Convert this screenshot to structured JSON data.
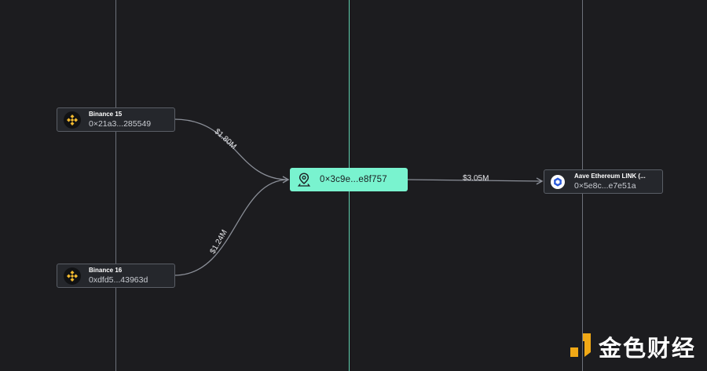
{
  "nodes": {
    "binance15": {
      "label": "Binance 15",
      "address": "0×21a3...285549"
    },
    "binance16": {
      "label": "Binance 16",
      "address": "0xdfd5...43963d"
    },
    "center": {
      "address": "0×3c9e...e8f757"
    },
    "aave": {
      "label": "Aave Ethereum LINK (...",
      "address": "0×5e8c...e7e51a"
    }
  },
  "edges": {
    "b15_to_center": "$1.80M",
    "b16_to_center": "$1.24M",
    "center_to_aave": "$3.05M"
  },
  "watermark": {
    "text": "金色财经"
  },
  "colors": {
    "background": "#1c1c1f",
    "center_node": "#79f3cf",
    "center_line": "#5fd0ad",
    "binance_yellow": "#f3ba2f",
    "chainlink_blue": "#2a5ada",
    "edge": "#8b8f98"
  },
  "icons": {
    "binance15": "binance-icon",
    "binance16": "binance-icon",
    "center": "map-pin-icon",
    "aave": "chainlink-icon",
    "watermark": "jinse-logo-icon"
  }
}
